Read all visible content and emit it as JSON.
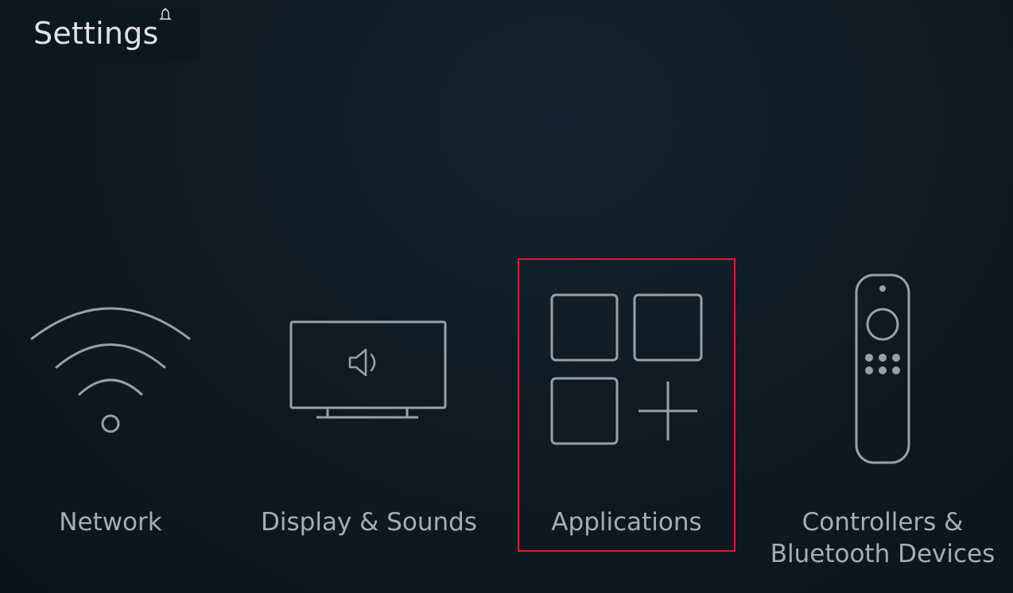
{
  "header": {
    "title": "Settings",
    "notification_icon": "bell-icon"
  },
  "tiles": [
    {
      "id": "network",
      "label": "Network",
      "icon": "wifi-icon"
    },
    {
      "id": "display",
      "label": "Display & Sounds",
      "icon": "tv-speaker-icon"
    },
    {
      "id": "applications",
      "label": "Applications",
      "icon": "apps-grid-plus-icon",
      "selected": true
    },
    {
      "id": "controllers",
      "label_line1": "Controllers &",
      "label_line2": "Bluetooth Devices",
      "icon": "remote-control-icon"
    }
  ],
  "colors": {
    "background": "#0f1a23",
    "icon_stroke": "#9aa1a6",
    "focus_border": "#e21c2d",
    "title_text": "#dfe3e6",
    "label_text": "#a7aeb3"
  }
}
